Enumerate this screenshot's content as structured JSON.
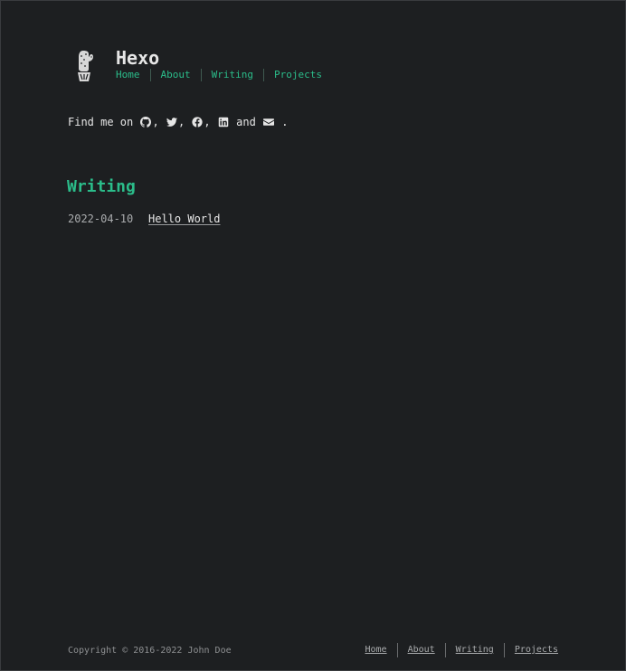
{
  "site": {
    "title": "Hexo",
    "logo_icon": "cactus-logo-icon"
  },
  "nav": [
    {
      "label": "Home"
    },
    {
      "label": "About"
    },
    {
      "label": "Writing"
    },
    {
      "label": "Projects"
    }
  ],
  "find_me": {
    "prefix": "Find me on ",
    "comma": ",",
    "and": " and ",
    "end": " .",
    "icons": [
      "github-icon",
      "twitter-icon",
      "facebook-icon",
      "linkedin-icon",
      "email-icon"
    ]
  },
  "writing": {
    "heading": "Writing",
    "posts": [
      {
        "date": "2022-04-10",
        "title": "Hello World"
      }
    ]
  },
  "footer": {
    "copyright": "Copyright © 2016-2022 John Doe",
    "nav": [
      {
        "label": "Home"
      },
      {
        "label": "About"
      },
      {
        "label": "Writing"
      },
      {
        "label": "Projects"
      }
    ]
  },
  "colors": {
    "background": "#1d1f21",
    "accent": "#2bbc8a",
    "text": "#e6e6e6"
  }
}
